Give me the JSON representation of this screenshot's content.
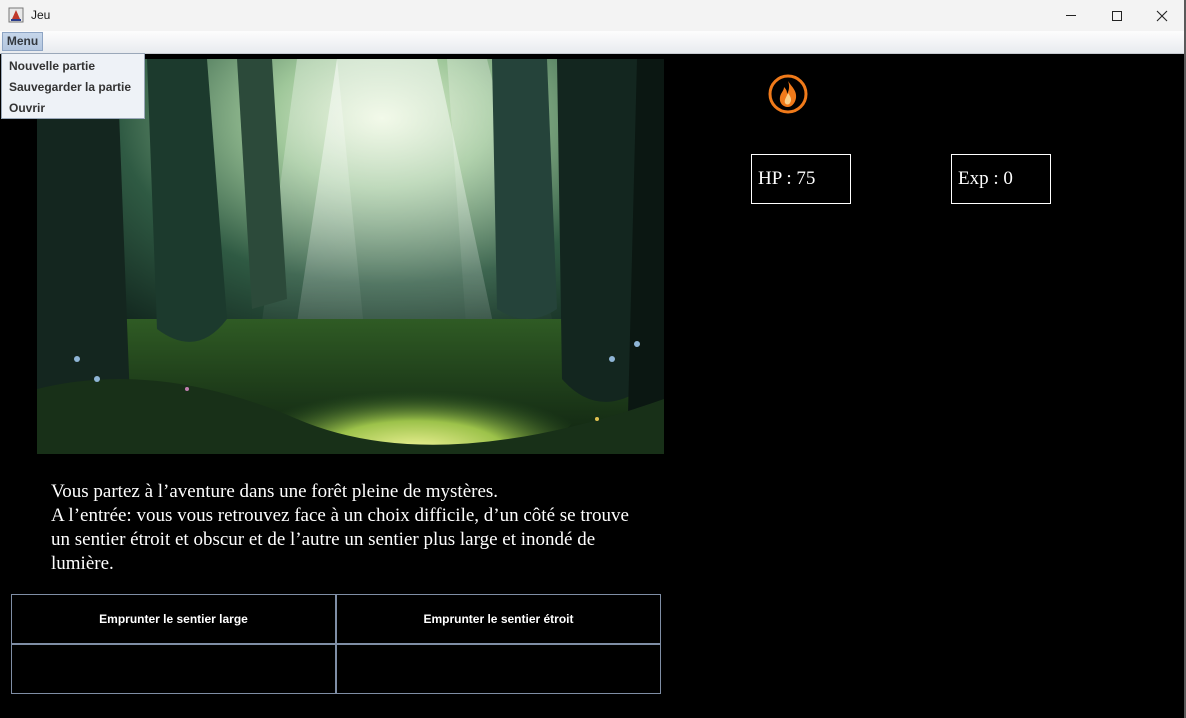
{
  "window": {
    "title": "Jeu"
  },
  "menubar": {
    "menu_label": "Menu"
  },
  "menu_items": [
    "Nouvelle partie",
    "Sauvegarder la partie",
    "Ouvrir"
  ],
  "stats": {
    "hp_label": "HP :  75",
    "exp_label": "Exp : 0"
  },
  "story": {
    "lines": [
      "Vous partez à l’aventure dans une forêt pleine de mystères.",
      "A l’entrée: vous vous retrouvez face à un choix difficile, d’un côté se trouve",
      "un sentier étroit et obscur et de l’autre un sentier plus large et inondé de",
      "lumière."
    ]
  },
  "choices": [
    "Emprunter le sentier large",
    "Emprunter le sentier étroit",
    "",
    ""
  ],
  "icons": {
    "app": "java-app-icon",
    "status": "fire-icon",
    "window_controls": [
      "minimize-icon",
      "maximize-icon",
      "close-icon"
    ]
  },
  "colors": {
    "background": "#000000",
    "fire": "#f07a1a",
    "menu_active": "#b9cbe3"
  }
}
